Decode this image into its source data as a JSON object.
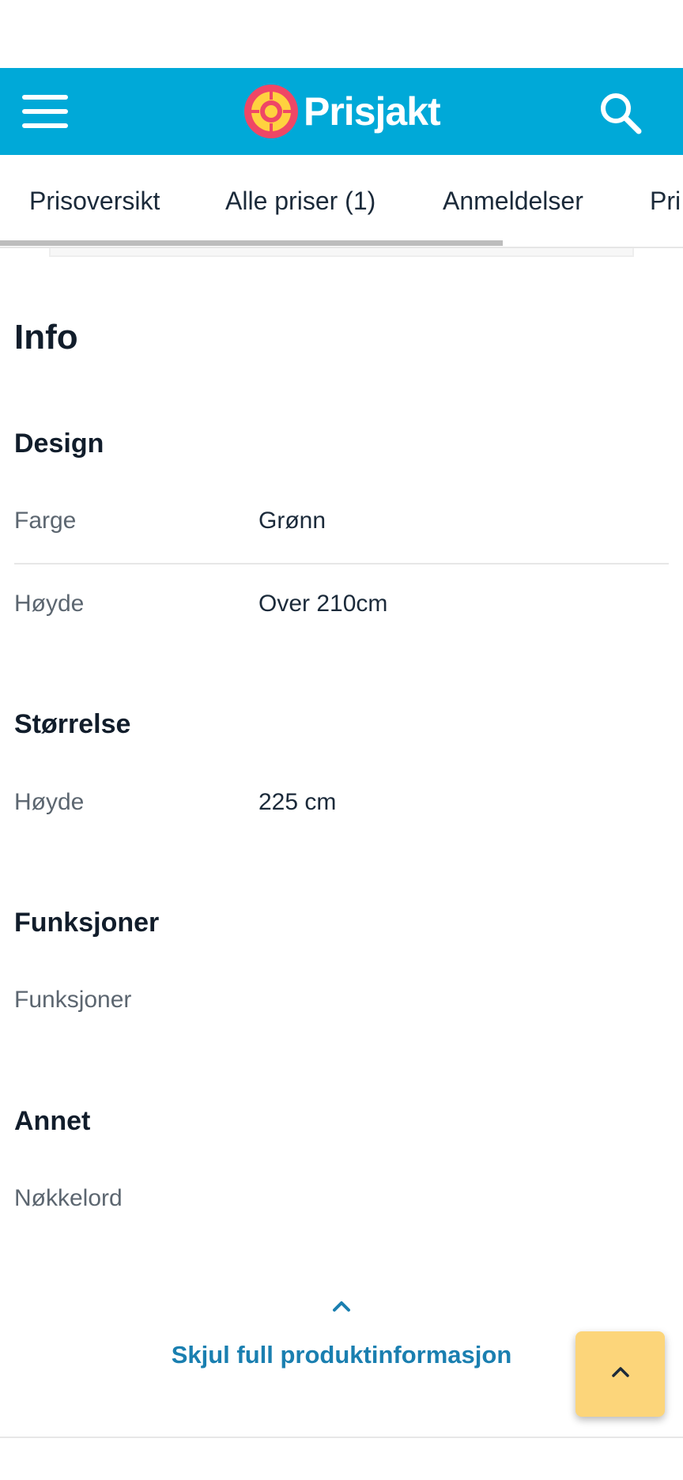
{
  "header": {
    "brand_name": "Prisjakt",
    "background_color": "#00a9d8",
    "menu_icon": "hamburger-menu-icon",
    "search_icon": "search-icon"
  },
  "tabs": [
    {
      "label": "Prisoversikt"
    },
    {
      "label": "Alle priser (1)"
    },
    {
      "label": "Anmeldelser"
    },
    {
      "label": "Pri"
    }
  ],
  "info": {
    "title": "Info",
    "sections": [
      {
        "title": "Design",
        "rows": [
          {
            "label": "Farge",
            "value": "Grønn"
          },
          {
            "label": "Høyde",
            "value": "Over 210cm"
          }
        ]
      },
      {
        "title": "Størrelse",
        "rows": [
          {
            "label": "Høyde",
            "value": "225 cm"
          }
        ]
      },
      {
        "title": "Funksjoner",
        "rows": [
          {
            "label": "Funksjoner",
            "value": ""
          }
        ]
      },
      {
        "title": "Annet",
        "rows": [
          {
            "label": "Nøkkelord",
            "value": ""
          }
        ]
      }
    ]
  },
  "footer": {
    "collapse_label": "Skjul full produktinformasjon",
    "collapse_icon": "chevron-up-icon",
    "scroll_top_icon": "chevron-up-icon",
    "scroll_top_color": "#fcd57a",
    "link_color": "#1a7fb0"
  }
}
